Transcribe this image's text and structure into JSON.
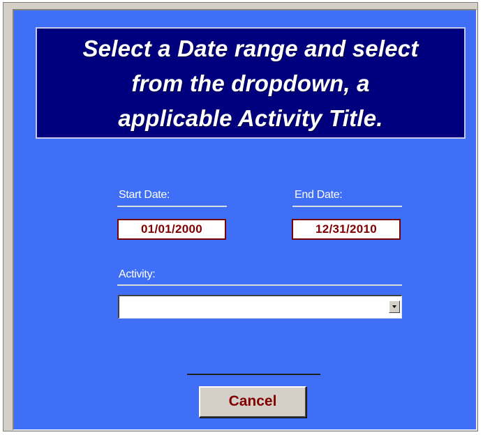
{
  "banner": {
    "line1": "Select a Date range and select",
    "line2": "from the dropdown, a",
    "line3": "applicable Activity Title."
  },
  "start_date": {
    "label": "Start Date:",
    "value": "01/01/2000"
  },
  "end_date": {
    "label": "End Date:",
    "value": "12/31/2010"
  },
  "activity": {
    "label": "Activity:",
    "value": ""
  },
  "actions": {
    "cancel_label": "Cancel"
  },
  "colors": {
    "form_background": "#3f6ff7",
    "banner_background": "#00007f",
    "value_text": "#800000",
    "button_face": "#d4d0c8"
  }
}
